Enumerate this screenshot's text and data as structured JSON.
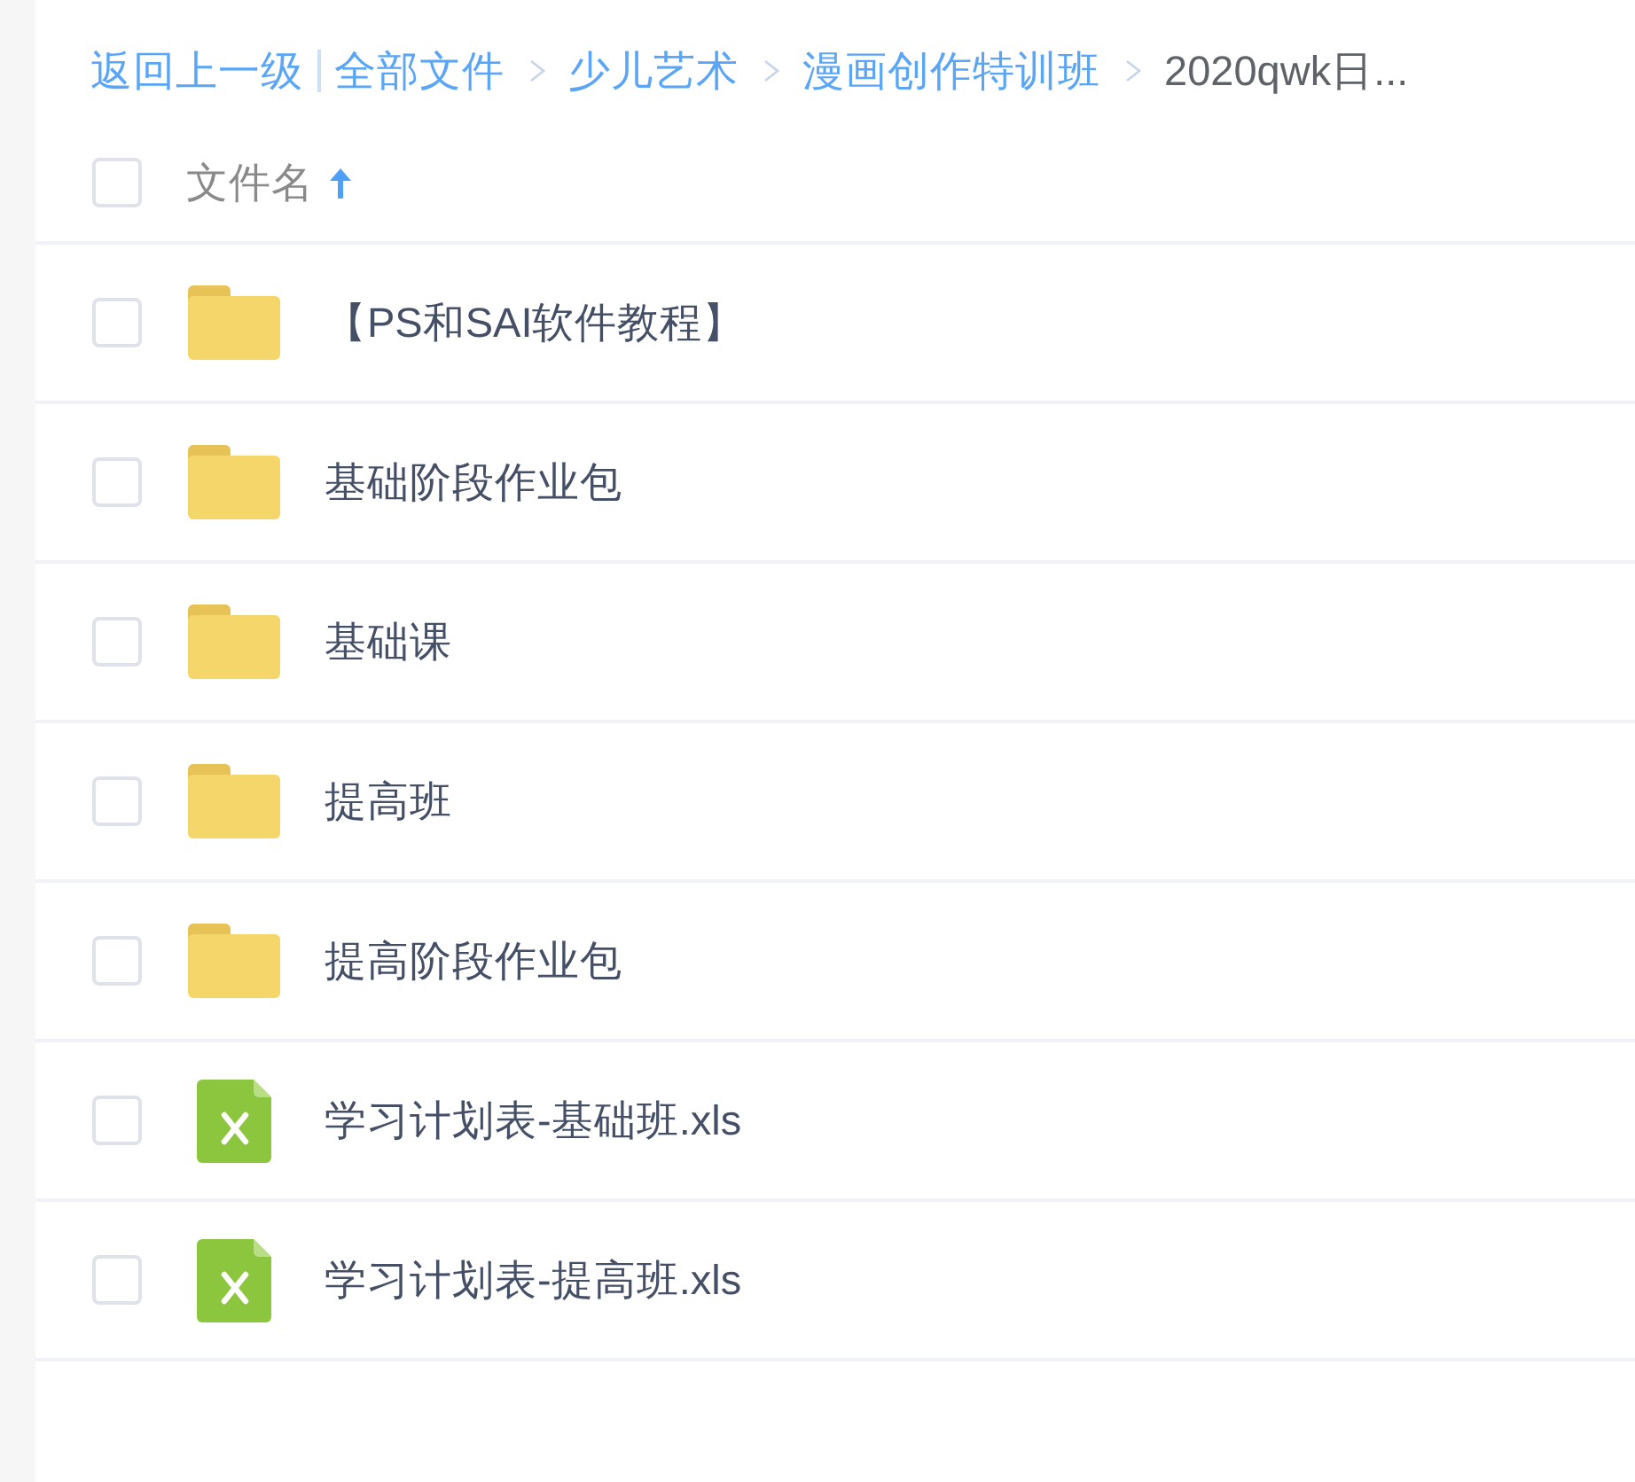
{
  "breadcrumb": {
    "back": "返回上一级",
    "path": [
      {
        "label": "全部文件",
        "current": false
      },
      {
        "label": "少儿艺术",
        "current": false
      },
      {
        "label": "漫画创作特训班",
        "current": false
      },
      {
        "label": "2020qwk日...",
        "current": true
      }
    ]
  },
  "header": {
    "checked": false,
    "column": "文件名",
    "sorted": true
  },
  "files": [
    {
      "kind": "folder",
      "name": "【PS和SAI软件教程】",
      "checked": false
    },
    {
      "kind": "folder",
      "name": "基础阶段作业包",
      "checked": false
    },
    {
      "kind": "folder",
      "name": "基础课",
      "checked": false
    },
    {
      "kind": "folder",
      "name": "提高班",
      "checked": false
    },
    {
      "kind": "folder",
      "name": "提高阶段作业包",
      "checked": false
    },
    {
      "kind": "excel",
      "name": "学习计划表-基础班.xls",
      "checked": false
    },
    {
      "kind": "excel",
      "name": "学习计划表-提高班.xls",
      "checked": false
    }
  ]
}
